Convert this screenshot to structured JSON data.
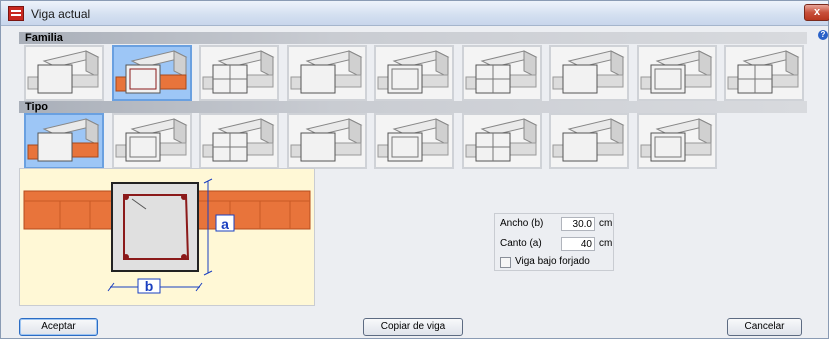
{
  "window": {
    "title": "Viga actual",
    "close_glyph": "x",
    "help_glyph": "?"
  },
  "familia": {
    "heading": "Familia",
    "items": [
      {
        "icon": "rectangular-beam-icon",
        "selected": false
      },
      {
        "icon": "rectangular-beam-on-brick-icon",
        "selected": true
      },
      {
        "icon": "triangle-section-beam-icon",
        "selected": false
      },
      {
        "icon": "joist-slab-beam-icon",
        "selected": false
      },
      {
        "icon": "beam-with-plate-icon",
        "selected": false
      },
      {
        "icon": "concrete-block-beam-icon",
        "selected": false
      },
      {
        "icon": "slab-strip-icon",
        "selected": false
      },
      {
        "icon": "steel-i-beam-icon",
        "selected": false
      },
      {
        "icon": "beam-block-icon",
        "selected": false
      }
    ]
  },
  "tipo": {
    "heading": "Tipo",
    "items": [
      {
        "icon": "rectangular-hollow-type-icon",
        "selected": true
      },
      {
        "icon": "rectangular-type-2-icon",
        "selected": false
      },
      {
        "icon": "rectangular-type-3-icon",
        "selected": false
      },
      {
        "icon": "cross-section-type-4-icon",
        "selected": false
      },
      {
        "icon": "cross-section-type-5-icon",
        "selected": false
      },
      {
        "icon": "t-section-type-6-icon",
        "selected": false
      },
      {
        "icon": "t-section-type-7-icon",
        "selected": false
      },
      {
        "icon": "box-section-type-8-icon",
        "selected": false
      }
    ]
  },
  "preview": {
    "label_a": "a",
    "label_b": "b"
  },
  "params": {
    "ancho_label": "Ancho (b)",
    "ancho_value": "30.0",
    "ancho_unit": "cm",
    "canto_label": "Canto (a)",
    "canto_value": "40",
    "canto_unit": "cm",
    "viga_bajo_forjado_label": "Viga bajo forjado",
    "viga_bajo_forjado_checked": false
  },
  "buttons": {
    "accept": "Aceptar",
    "copy": "Copiar de viga",
    "cancel": "Cancelar"
  },
  "colors": {
    "brick": "#e8743b",
    "rebar": "#8b1a1a",
    "highlight": "#9dc6f6",
    "dimension": "#1a3fc0"
  }
}
